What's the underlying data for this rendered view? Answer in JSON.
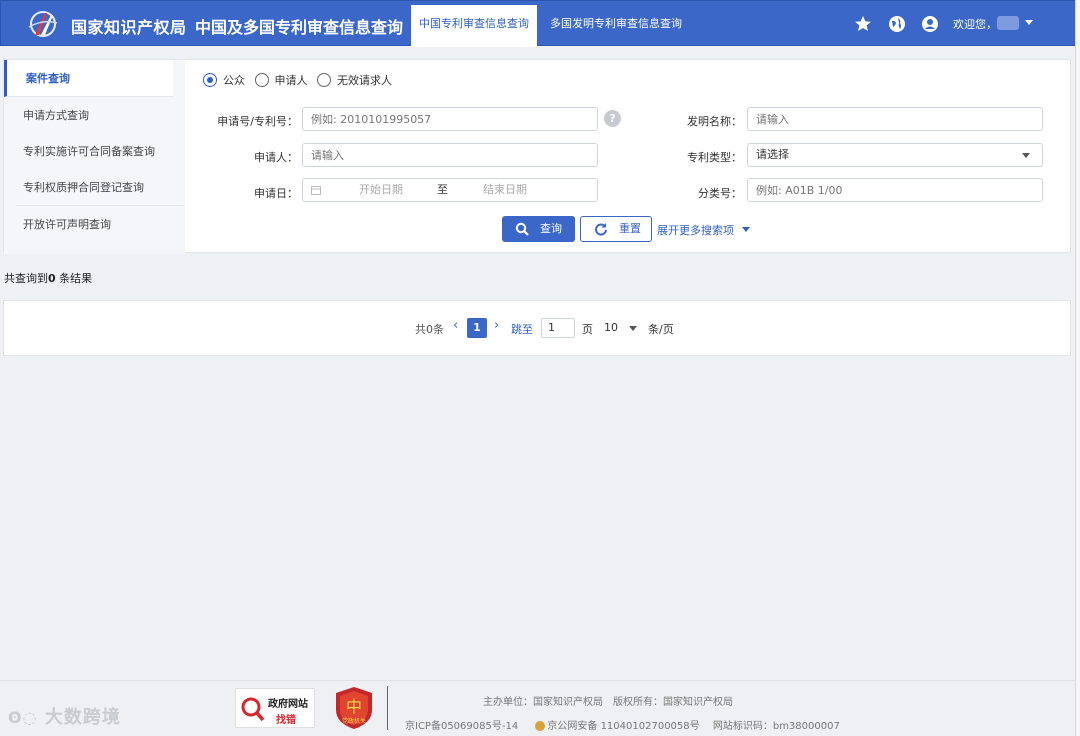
{
  "header": {
    "brand": "国家知识产权局",
    "system_title": "中国及多国专利审查信息查询",
    "tabs": [
      {
        "label": "中国专利审查信息查询",
        "active": true
      },
      {
        "label": "多国发明专利审查信息查询",
        "active": false
      }
    ],
    "welcome": "欢迎您，",
    "icons": [
      "star-icon",
      "globe-icon",
      "user-icon",
      "chevron-down-icon"
    ]
  },
  "sidebar": {
    "items": [
      {
        "label": "案件查询",
        "active": true
      },
      {
        "label": "申请方式查询",
        "active": false
      },
      {
        "label": "专利实施许可合同备案查询",
        "active": false
      },
      {
        "label": "专利权质押合同登记查询",
        "active": false
      },
      {
        "label": "开放许可声明查询",
        "active": false
      }
    ]
  },
  "form": {
    "roles": [
      {
        "label": "公众",
        "checked": true
      },
      {
        "label": "申请人",
        "checked": false
      },
      {
        "label": "无效请求人",
        "checked": false
      }
    ],
    "app_no_label": "申请号/专利号：",
    "app_no_placeholder": "例如: 2010101995057",
    "invention_name_label": "发明名称：",
    "invention_name_placeholder": "请输入",
    "applicant_label": "申请人：",
    "applicant_placeholder": "请输入",
    "patent_type_label": "专利类型：",
    "patent_type_value": "请选择",
    "app_date_label": "申请日：",
    "start_date_placeholder": "开始日期",
    "date_sep": "至",
    "end_date_placeholder": "结束日期",
    "class_no_label": "分类号：",
    "class_no_placeholder": "例如: A01B 1/00",
    "help_glyph": "?",
    "search_label": "查询",
    "reset_label": "重置",
    "expand_label": "展开更多搜索项"
  },
  "results": {
    "prefix": "共查询到",
    "count": "0",
    "suffix": "条结果"
  },
  "pagination": {
    "total": "共0条",
    "current_page": "1",
    "jump_label": "跳至",
    "jump_value": "1",
    "page_unit": "页",
    "page_size": "10",
    "size_unit": "条/页"
  },
  "footer": {
    "badge_gov_line1": "政府网站",
    "badge_gov_line2": "找错",
    "badge_party": "党政机关",
    "sponsor": "主办单位：国家知识产权局　版权所有：国家知识产权局",
    "icp": "京ICP备05069085号-14",
    "police": "京公网安备 11040102700058号",
    "site_code": "网站标识码：bm38000007",
    "watermark": "大数跨境"
  },
  "colors": {
    "primary": "#3a67c8",
    "header_bg": "#3a67c8",
    "active_text": "#2f5fc4"
  }
}
